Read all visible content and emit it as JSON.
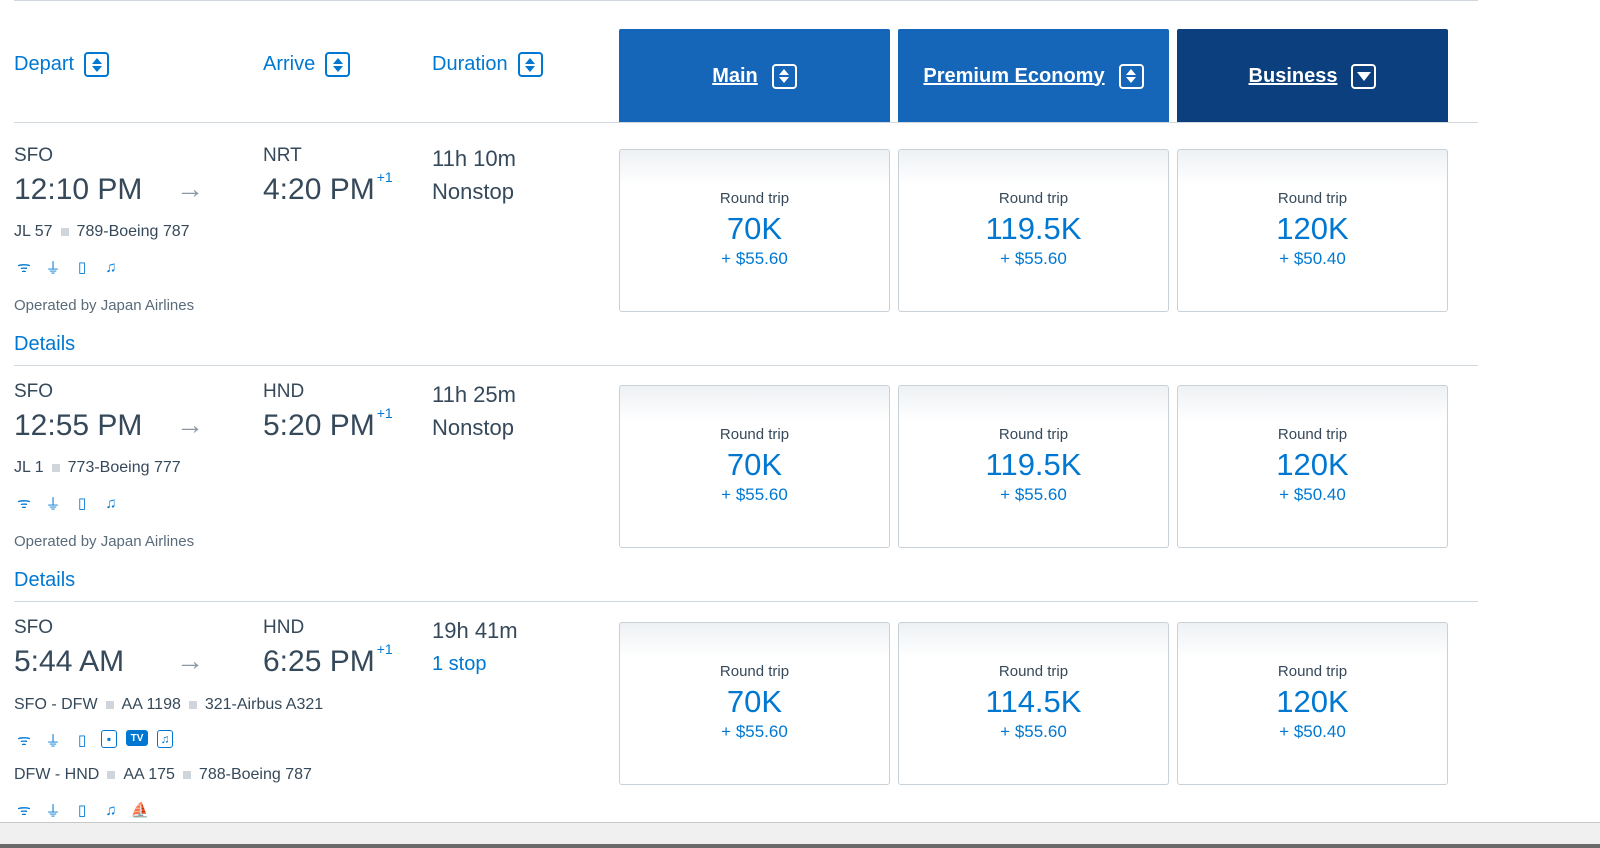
{
  "columns": {
    "depart": "Depart",
    "arrive": "Arrive",
    "duration": "Duration"
  },
  "cabins": [
    {
      "label": "Main",
      "sort": "both"
    },
    {
      "label": "Premium Economy",
      "sort": "both"
    },
    {
      "label": "Business",
      "sort": "descending"
    }
  ],
  "flights": [
    {
      "from": "SFO",
      "depart_time": "12:10 PM",
      "to": "NRT",
      "arrive_time": "4:20 PM",
      "day_offset": "+1",
      "duration": "11h 10m",
      "stops": "Nonstop",
      "segments": [
        {
          "route": "",
          "flight": "JL 57",
          "aircraft": "789-Boeing 787",
          "amenities": [
            "wifi-icon",
            "power-icon",
            "usb-icon",
            "entertainment-icon"
          ]
        }
      ],
      "operated_by": "Operated by Japan Airlines",
      "details": "Details",
      "fares": [
        {
          "label": "Round trip",
          "points": "70K",
          "tax": "+ $55.60"
        },
        {
          "label": "Round trip",
          "points": "119.5K",
          "tax": "+ $55.60"
        },
        {
          "label": "Round trip",
          "points": "120K",
          "tax": "+ $50.40"
        }
      ]
    },
    {
      "from": "SFO",
      "depart_time": "12:55 PM",
      "to": "HND",
      "arrive_time": "5:20 PM",
      "day_offset": "+1",
      "duration": "11h 25m",
      "stops": "Nonstop",
      "segments": [
        {
          "route": "",
          "flight": "JL 1",
          "aircraft": "773-Boeing 777",
          "amenities": [
            "wifi-icon",
            "power-icon",
            "usb-icon",
            "entertainment-icon"
          ]
        }
      ],
      "operated_by": "Operated by Japan Airlines",
      "details": "Details",
      "fares": [
        {
          "label": "Round trip",
          "points": "70K",
          "tax": "+ $55.60"
        },
        {
          "label": "Round trip",
          "points": "119.5K",
          "tax": "+ $55.60"
        },
        {
          "label": "Round trip",
          "points": "120K",
          "tax": "+ $50.40"
        }
      ]
    },
    {
      "from": "SFO",
      "depart_time": "5:44 AM",
      "to": "HND",
      "arrive_time": "6:25 PM",
      "day_offset": "+1",
      "duration": "19h 41m",
      "stops": "1 stop",
      "segments": [
        {
          "route": "SFO - DFW",
          "flight": "AA 1198",
          "aircraft": "321-Airbus A321",
          "amenities": [
            "wifi-icon",
            "power-icon",
            "usb-icon",
            "seatback-screen-icon",
            "tv-icon",
            "music-icon"
          ]
        },
        {
          "route": "DFW - HND",
          "flight": "AA 175",
          "aircraft": "788-Boeing 787",
          "amenities": [
            "wifi-icon",
            "power-icon",
            "usb-icon",
            "entertainment-icon",
            "lie-flat-seat-icon"
          ]
        }
      ],
      "fares": [
        {
          "label": "Round trip",
          "points": "70K",
          "tax": "+ $55.60"
        },
        {
          "label": "Round trip",
          "points": "114.5K",
          "tax": "+ $55.60"
        },
        {
          "label": "Round trip",
          "points": "120K",
          "tax": "+ $50.40"
        }
      ]
    }
  ],
  "colors": {
    "accent": "#0078d2",
    "cabin_header": "#1565b8",
    "cabin_header_selected": "#0b3f7d",
    "text": "#36495a"
  }
}
